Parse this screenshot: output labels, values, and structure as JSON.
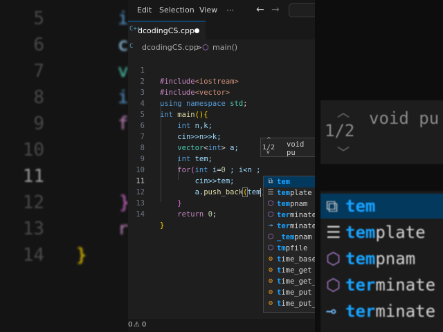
{
  "background_left": {
    "line_numbers": [
      "5",
      "6",
      "7",
      "8",
      "9",
      "10",
      "11",
      "12",
      "13",
      "14"
    ],
    "fragments": [
      {
        "text": "i",
        "color": "#569cd6"
      },
      {
        "text": "c",
        "color": "#9cdcfe"
      },
      {
        "text": "v",
        "color": "#4ec9b0"
      },
      {
        "text": "i",
        "color": "#569cd6"
      },
      {
        "text": "f",
        "color": "#c586c0"
      },
      {
        "text": "}",
        "color": "#da70d6"
      },
      {
        "text": "r",
        "color": "#c586c0"
      },
      {
        "text": "}",
        "color": "#ffd700"
      }
    ]
  },
  "background_right": {
    "counter": "1/2",
    "signature": "void pu",
    "items": [
      {
        "icon": "snippet",
        "match": "tem",
        "rest": ""
      },
      {
        "icon": "keyword",
        "match": "tem",
        "rest": "plate"
      },
      {
        "icon": "function",
        "match": "tem",
        "rest": "pnam"
      },
      {
        "icon": "function",
        "match": "ter",
        "rest": "minate"
      },
      {
        "icon": "variable",
        "match": "ter",
        "rest": "minate"
      }
    ]
  },
  "menu": {
    "items": [
      "Edit",
      "Selection",
      "View",
      "⋯"
    ],
    "back_icon": "←",
    "forward_icon": "→"
  },
  "tab": {
    "icon": "C++",
    "name": "dcodingCS.cpp"
  },
  "breadcrumb": {
    "file": "dcodingCS.cpp",
    "separator": ">",
    "symbol": "main()"
  },
  "code": {
    "lines": [
      {
        "n": "1"
      },
      {
        "n": "2"
      },
      {
        "n": "3"
      },
      {
        "n": "4"
      },
      {
        "n": "5"
      },
      {
        "n": "6"
      },
      {
        "n": "7"
      },
      {
        "n": "8"
      },
      {
        "n": "9"
      },
      {
        "n": "10"
      },
      {
        "n": "11"
      },
      {
        "n": "12"
      },
      {
        "n": "13"
      },
      {
        "n": "14"
      }
    ],
    "tokens": {
      "l1_dir": "#include",
      "l1_hdr": "<iostream>",
      "l2_dir": "#include",
      "l2_hdr": "<vector>",
      "l3_using": "using",
      "l3_ns": "namespace",
      "l3_std": "std",
      "l3_semi": ";",
      "l4_int": "int",
      "l4_main": "main",
      "l4_parens": "()",
      "l4_brace": "{",
      "l5_int": "int",
      "l5_rest": "n,k;",
      "l6_cin": "cin",
      "l6_rest": ">>n>>k;",
      "l7_vector": "vector",
      "l7_lt": "<",
      "l7_int": "int",
      "l7_gt": ">",
      "l7_rest": " a;",
      "l8_int": "int",
      "l8_rest": "tem;",
      "l9_for": "for",
      "l9_open": "(",
      "l9_int": "int",
      "l9_i": "i",
      "l9_eq": "=",
      "l9_zero": "0",
      "l9_rest": " ; i<n ;",
      "l10_cin": "cin",
      "l10_rest": ">>tem;",
      "l11_a": "a",
      "l11_dot": ".",
      "l11_fn": "push_back",
      "l11_open": "(",
      "l11_arg": "tem",
      "l11_close": ")",
      "l12_brace": "}",
      "l13_return": "return",
      "l13_zero": "0",
      "l13_semi": ";",
      "l14_brace": "}"
    },
    "current_line": "11"
  },
  "parameter_hint": {
    "up_icon": "^",
    "down_icon": "v",
    "counter": "1/2",
    "signature": "void pu"
  },
  "suggestions": [
    {
      "icon": "snippet",
      "glyph": "⧉",
      "match": "tem",
      "rest": "",
      "selected": true
    },
    {
      "icon": "keyword",
      "glyph": "☰",
      "match": "tem",
      "rest": "plate",
      "selected": false
    },
    {
      "icon": "function",
      "glyph": "⬡",
      "match": "tem",
      "rest": "pnam",
      "selected": false
    },
    {
      "icon": "function",
      "glyph": "⬡",
      "match": "ter",
      "rest": "minate",
      "selected": false
    },
    {
      "icon": "variable",
      "glyph": "⊸",
      "match": "ter",
      "rest": "minate",
      "selected": false
    },
    {
      "icon": "function",
      "glyph": "⬡",
      "match": "_tem",
      "rest": "pnam",
      "selected": false
    },
    {
      "icon": "function",
      "glyph": "⬡",
      "match": "tm",
      "rest": "pfile",
      "selected": false
    },
    {
      "icon": "class",
      "glyph": "⚙",
      "match": "t",
      "rest": "ime_base",
      "selected": false
    },
    {
      "icon": "class",
      "glyph": "⚙",
      "match": "t",
      "rest": "ime_get",
      "selected": false
    },
    {
      "icon": "class",
      "glyph": "⚙",
      "match": "t",
      "rest": "ime_get_",
      "selected": false
    },
    {
      "icon": "class",
      "glyph": "⚙",
      "match": "t",
      "rest": "ime_put",
      "selected": false
    },
    {
      "icon": "class",
      "glyph": "⚙",
      "match": "t",
      "rest": "ime_put_",
      "selected": false
    }
  ],
  "status": {
    "errors": "0",
    "warning_icon": "⚠",
    "warnings": "0"
  }
}
